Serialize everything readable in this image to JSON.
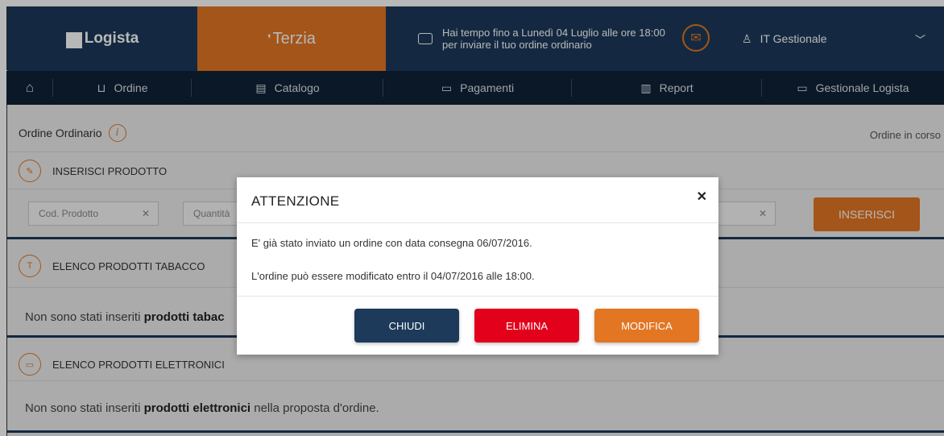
{
  "header": {
    "brand_left": "Logista",
    "brand_right": "Terzia",
    "deadline_line1": "Hai tempo fino a Lunedì 04 Luglio alle ore 18:00",
    "deadline_line2": "per inviare il tuo ordine ordinario",
    "user_label": "IT Gestionale"
  },
  "nav": {
    "items": [
      {
        "label": ""
      },
      {
        "label": "Ordine"
      },
      {
        "label": "Catalogo"
      },
      {
        "label": "Pagamenti"
      },
      {
        "label": "Report"
      },
      {
        "label": "Gestionale Logista"
      }
    ]
  },
  "page": {
    "title": "Ordine Ordinario",
    "status": "Ordine in corso",
    "insert_section": "INSERISCI PRODOTTO",
    "code_placeholder": "Cod. Prodotto",
    "qty_placeholder": "Quantità",
    "insert_button": "INSERISCI",
    "tobacco_badge": "T",
    "tobacco_section": "ELENCO PRODOTTI TABACCO",
    "tobacco_empty_prefix": "Non sono stati inseriti ",
    "tobacco_empty_bold": "prodotti tabac",
    "electronic_section": "ELENCO PRODOTTI ELETTRONICI",
    "electronic_empty_prefix": "Non sono stati inseriti ",
    "electronic_empty_bold": "prodotti elettronici",
    "electronic_empty_suffix": " nella proposta d'ordine."
  },
  "modal": {
    "title": "ATTENZIONE",
    "line1": "E' già stato inviato un ordine con data consegna 06/07/2016.",
    "line2": "L'ordine può essere modificato entro il 04/07/2016 alle 18:00.",
    "close_label": "CHIUDI",
    "delete_label": "ELIMINA",
    "edit_label": "MODIFICA"
  },
  "colors": {
    "navy": "#1d3a5a",
    "orange": "#e37623",
    "red": "#e3001b",
    "dark_button": "#1d3a5a"
  }
}
